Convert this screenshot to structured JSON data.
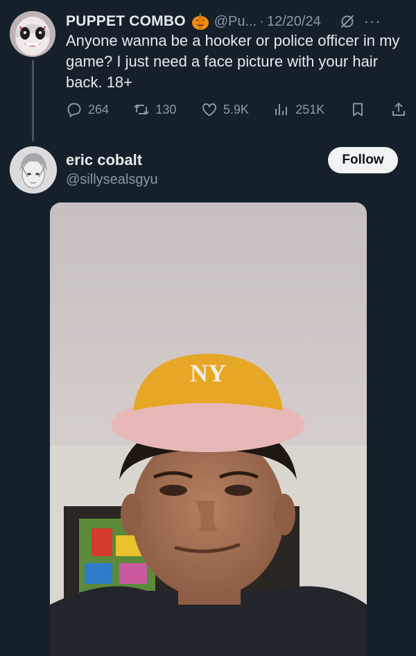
{
  "op_tweet": {
    "display_name": "PUPPET COMBO",
    "handle": "@Pu...",
    "separator": "·",
    "date": "12/20/24",
    "text": "Anyone wanna be a hooker or police officer in my game? I just need a face picture with your hair back. 18+",
    "more_label": "···",
    "stats": {
      "replies": "264",
      "reposts": "130",
      "likes": "5.9K",
      "views": "251K"
    }
  },
  "reply_tweet": {
    "display_name": "eric cobalt",
    "handle": "@sillysealsgyu",
    "follow_label": "Follow",
    "photo_cap_logo": "NY"
  },
  "colors": {
    "background": "#15202b",
    "text_primary": "#e7e9ea",
    "text_secondary": "#8b98a5",
    "follow_bg": "#eff3f4",
    "cap_yellow": "#e6a726",
    "cap_brim": "#e8b8b8"
  }
}
